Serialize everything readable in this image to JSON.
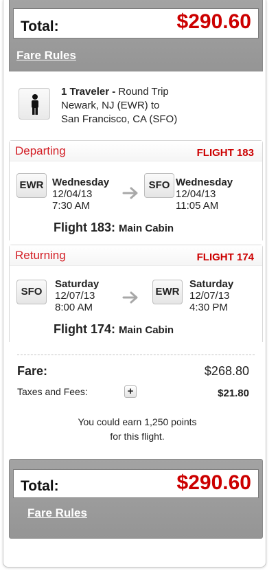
{
  "summary": {
    "total_label": "Total:",
    "total_value": "$290.60",
    "fare_rules": "Fare Rules"
  },
  "traveler": {
    "count": "1 Traveler -",
    "trip_type": "Round Trip",
    "origin": "Newark, NJ (EWR) to",
    "destination": "San Francisco, CA (SFO)"
  },
  "departing": {
    "title": "Departing",
    "flight_tag": "FLIGHT 183",
    "from_code": "EWR",
    "from_day": "Wednesday",
    "from_date": "12/04/13",
    "from_time": "7:30 AM",
    "to_code": "SFO",
    "to_day": "Wednesday",
    "to_date": "12/04/13",
    "to_time": "11:05 AM",
    "flight_label": "Flight 183:",
    "cabin": "Main Cabin"
  },
  "returning": {
    "title": "Returning",
    "flight_tag": "FLIGHT 174",
    "from_code": "SFO",
    "from_day": "Saturday",
    "from_date": "12/07/13",
    "from_time": "8:00 AM",
    "to_code": "EWR",
    "to_day": "Saturday",
    "to_date": "12/07/13",
    "to_time": "4:30 PM",
    "flight_label": "Flight 174:",
    "cabin": "Main Cabin"
  },
  "pricing": {
    "fare_label": "Fare:",
    "fare_value": "$268.80",
    "taxes_label": "Taxes and Fees:",
    "taxes_toggle": "+",
    "taxes_value": "$21.80",
    "points_line1": "You could earn 1,250 points",
    "points_line2": "for this flight."
  },
  "colors": {
    "accent_red": "#cc0000",
    "panel_gray": "#9b9b9b"
  }
}
